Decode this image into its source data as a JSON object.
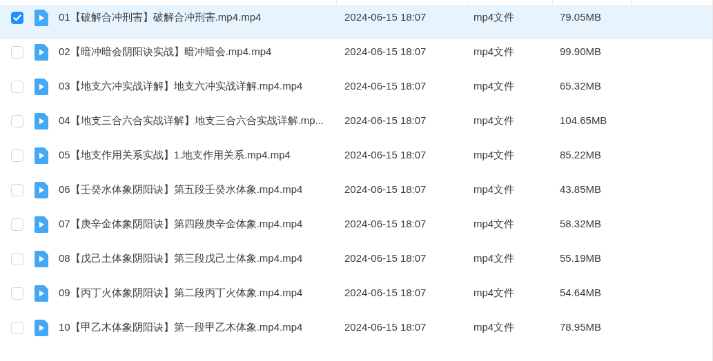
{
  "files": [
    {
      "selected": true,
      "name": "01【破解合冲刑害】破解合冲刑害.mp4.mp4",
      "modified": "2024-06-15 18:07",
      "type": "mp4文件",
      "size": "79.05MB"
    },
    {
      "selected": false,
      "name": "02【暗冲暗会阴阳诀实战】暗冲暗会.mp4.mp4",
      "modified": "2024-06-15 18:07",
      "type": "mp4文件",
      "size": "99.90MB"
    },
    {
      "selected": false,
      "name": "03【地支六冲实战详解】地支六冲实战详解.mp4.mp4",
      "modified": "2024-06-15 18:07",
      "type": "mp4文件",
      "size": "65.32MB"
    },
    {
      "selected": false,
      "name": "04【地支三合六合实战详解】地支三合六合实战详解.mp...",
      "modified": "2024-06-15 18:07",
      "type": "mp4文件",
      "size": "104.65MB"
    },
    {
      "selected": false,
      "name": "05【地支作用关系实战】1.地支作用关系.mp4.mp4",
      "modified": "2024-06-15 18:07",
      "type": "mp4文件",
      "size": "85.22MB"
    },
    {
      "selected": false,
      "name": "06【壬癸水体象阴阳诀】第五段壬癸水体象.mp4.mp4",
      "modified": "2024-06-15 18:07",
      "type": "mp4文件",
      "size": "43.85MB"
    },
    {
      "selected": false,
      "name": "07【庚辛金体象阴阳诀】第四段庚辛金体象.mp4.mp4",
      "modified": "2024-06-15 18:07",
      "type": "mp4文件",
      "size": "58.32MB"
    },
    {
      "selected": false,
      "name": "08【戊己土体象阴阳诀】第三段戊己土体象.mp4.mp4",
      "modified": "2024-06-15 18:07",
      "type": "mp4文件",
      "size": "55.19MB"
    },
    {
      "selected": false,
      "name": "09【丙丁火体象阴阳诀】第二段丙丁火体象.mp4.mp4",
      "modified": "2024-06-15 18:07",
      "type": "mp4文件",
      "size": "54.64MB"
    },
    {
      "selected": false,
      "name": "10【甲乙木体象阴阳诀】第一段甲乙木体象.mp4.mp4",
      "modified": "2024-06-15 18:07",
      "type": "mp4文件",
      "size": "78.95MB"
    }
  ]
}
